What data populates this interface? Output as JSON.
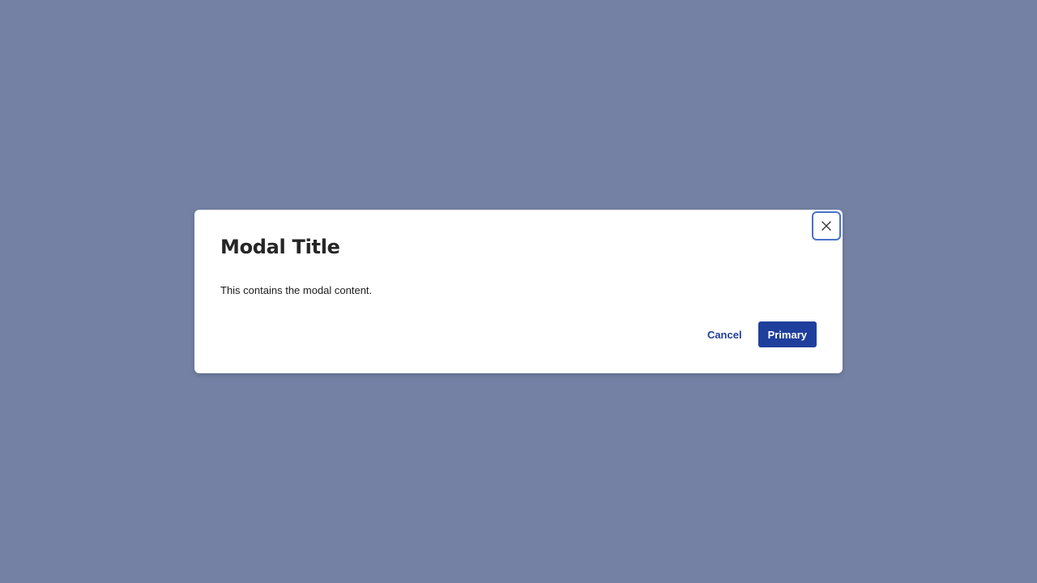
{
  "colors": {
    "overlay": "#7481a4",
    "modal_background": "#ffffff",
    "primary": "#1f3f9c",
    "focus_ring": "#4a72c8",
    "title_text": "#262626"
  },
  "modal": {
    "title": "Modal Title",
    "body": "This contains the modal content.",
    "close_icon": "close-icon",
    "cancel_label": "Cancel",
    "primary_label": "Primary"
  }
}
